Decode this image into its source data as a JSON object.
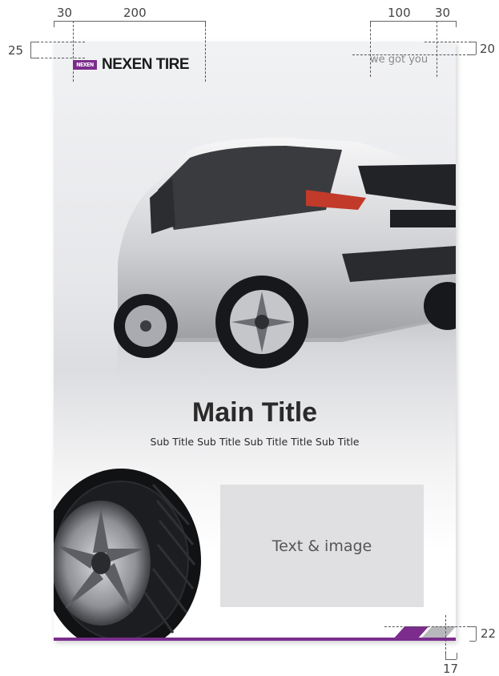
{
  "dimensions": {
    "top_left_margin": "30",
    "logo_width": "200",
    "tagline_width": "100",
    "top_right_margin": "30",
    "top_margin_left": "25",
    "top_margin_right": "20",
    "bottom_right_height": "22",
    "bottom_right_width": "17"
  },
  "poster": {
    "logo_mark": "NEXEN",
    "logo_text": "NEXEN TIRE",
    "tagline": "we got you",
    "main_title": "Main Title",
    "sub_title": "Sub Title Sub Title Sub Title Title Sub Title",
    "text_box_label": "Text & image"
  },
  "colors": {
    "brand_purple": "#7b2c8c",
    "stripe_gray": "#b8b8bc",
    "text_box_bg": "#e0e0e2"
  },
  "icons": [
    "logo-mark-icon",
    "car-image",
    "tire-image"
  ]
}
